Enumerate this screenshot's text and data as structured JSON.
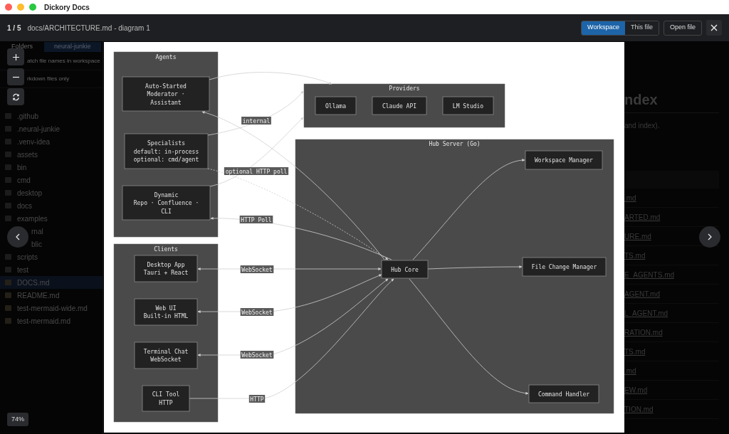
{
  "window": {
    "title": "Dickory Docs"
  },
  "viewer": {
    "counter": "1 / 5",
    "path": "docs/ARCHITECTURE.md - diagram 1",
    "scopes": [
      {
        "label": "Workspace",
        "selected": true
      },
      {
        "label": "This file",
        "selected": false
      }
    ],
    "open_button": "Open file",
    "zoom_level": "74%"
  },
  "background": {
    "sidebar": {
      "tabs": [
        {
          "label": "Folders",
          "selected": false
        },
        {
          "label": "neural-junkie",
          "selected": true
        }
      ],
      "options": [
        "atch file names in workspace",
        "rkdown files only"
      ],
      "items": [
        {
          "name": ".github",
          "kind": "folder",
          "selected": false
        },
        {
          "name": ".neural-junkie",
          "kind": "folder",
          "selected": false
        },
        {
          "name": ".venv-idea",
          "kind": "folder",
          "selected": false
        },
        {
          "name": "assets",
          "kind": "folder",
          "selected": false
        },
        {
          "name": "bin",
          "kind": "folder",
          "selected": false
        },
        {
          "name": "cmd",
          "kind": "folder",
          "selected": false
        },
        {
          "name": "desktop",
          "kind": "folder",
          "selected": false
        },
        {
          "name": "docs",
          "kind": "folder",
          "selected": false
        },
        {
          "name": "examples",
          "kind": "folder",
          "selected": false
        },
        {
          "name": "rnal",
          "kind": "covered",
          "selected": false
        },
        {
          "name": "blic",
          "kind": "covered",
          "selected": false
        },
        {
          "name": "scripts",
          "kind": "folder",
          "selected": false
        },
        {
          "name": "test",
          "kind": "folder",
          "selected": false
        },
        {
          "name": "DOCS.md",
          "kind": "file",
          "selected": true
        },
        {
          "name": "README.md",
          "kind": "file",
          "selected": false
        },
        {
          "name": "test-mermaid-wide.md",
          "kind": "file",
          "selected": false
        },
        {
          "name": "test-mermaid.md",
          "kind": "file",
          "selected": false
        }
      ]
    },
    "content": {
      "heading": "ndex",
      "text": "and index).",
      "links": [
        ".md",
        "ARTED.md",
        "URE.md",
        "TS.md",
        "E_AGENTS.md",
        "AGENT.md",
        "L_AGENT.md",
        "RATION.md",
        "TS.md",
        ".md",
        "EW.md",
        "TION.md"
      ]
    }
  },
  "diagram": {
    "groups": [
      {
        "title": "Agents",
        "nodes": [
          {
            "lines": [
              "Auto-Started",
              "Moderator ·",
              "Assistant"
            ]
          },
          {
            "lines": [
              "Specialists",
              "default: in-process",
              "optional: cmd/agent"
            ]
          },
          {
            "lines": [
              "Dynamic",
              "Repo · Confluence ·",
              "CLI"
            ]
          }
        ]
      },
      {
        "title": "Clients",
        "nodes": [
          {
            "lines": [
              "Desktop App",
              "Tauri + React"
            ]
          },
          {
            "lines": [
              "Web UI",
              "Built-in HTML"
            ]
          },
          {
            "lines": [
              "Terminal Chat",
              "WebSocket"
            ]
          },
          {
            "lines": [
              "CLI Tool",
              "HTTP"
            ]
          }
        ]
      },
      {
        "title": "Providers",
        "nodes": [
          {
            "lines": [
              "Ollama"
            ]
          },
          {
            "lines": [
              "Claude API"
            ]
          },
          {
            "lines": [
              "LM Studio"
            ]
          }
        ]
      },
      {
        "title": "Hub Server (Go)",
        "nodes": [
          {
            "lines": [
              "Workspace Manager"
            ]
          },
          {
            "lines": [
              "Hub Core"
            ]
          },
          {
            "lines": [
              "File Change Manager"
            ]
          },
          {
            "lines": [
              "Command Handler"
            ]
          }
        ]
      }
    ],
    "edge_labels": [
      "internal",
      "optional HTTP poll",
      "HTTP Poll",
      "WebSocket",
      "WebSocket",
      "WebSocket",
      "HTTP"
    ]
  }
}
